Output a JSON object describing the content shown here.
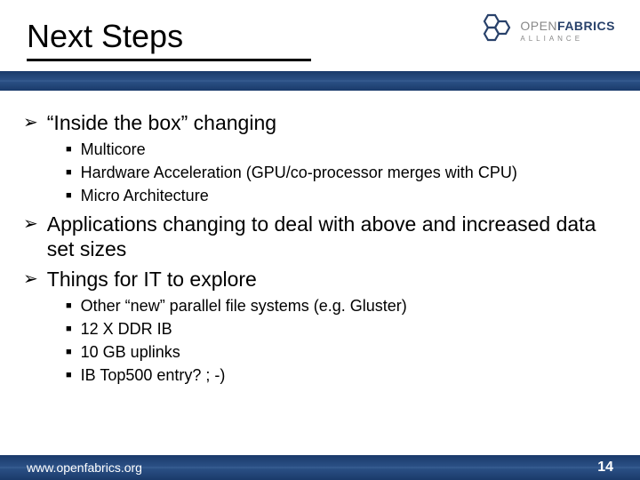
{
  "title": "Next Steps",
  "logo": {
    "open": "OPEN",
    "fabrics": "FABRICS",
    "alliance": "ALLIANCE"
  },
  "bullets": {
    "b1": "“Inside the box” changing",
    "b1_sub": {
      "s1": "Multicore",
      "s2": "Hardware Acceleration (GPU/co-processor merges with CPU)",
      "s3": "Micro Architecture"
    },
    "b2": "Applications changing to deal with above and increased data set sizes",
    "b3": "Things for IT to explore",
    "b3_sub": {
      "s1": "Other “new” parallel file systems (e.g. Gluster)",
      "s2": "12 X DDR IB",
      "s3": "10 GB uplinks",
      "s4": "IB Top500 entry? ; -)"
    }
  },
  "footer": {
    "url": "www.openfabrics.org",
    "page": "14"
  }
}
